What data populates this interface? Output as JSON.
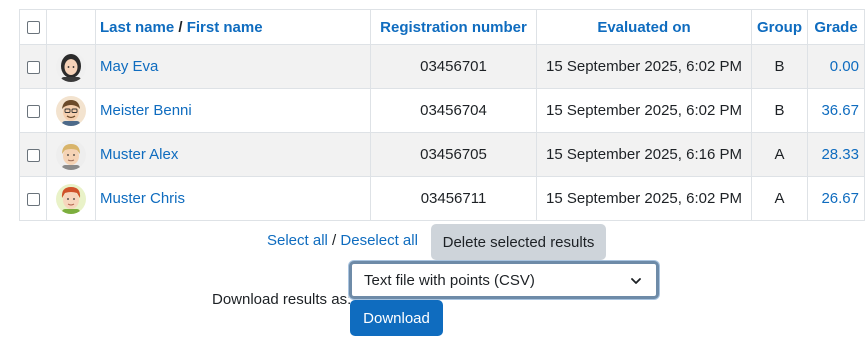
{
  "table": {
    "headers": {
      "last_name": "Last name",
      "separator": " / ",
      "first_name": "First name",
      "registration": "Registration number",
      "evaluated": "Evaluated on",
      "group": "Group",
      "grade": "Grade"
    },
    "rows": [
      {
        "name": "May Eva",
        "registration": "03456701",
        "evaluated": "15 September 2025, 6:02 PM",
        "group": "B",
        "grade": "0.00",
        "avatar": "female-avatar-dark-hair"
      },
      {
        "name": "Meister Benni",
        "registration": "03456704",
        "evaluated": "15 September 2025, 6:02 PM",
        "group": "B",
        "grade": "36.67",
        "avatar": "male-avatar-glasses"
      },
      {
        "name": "Muster Alex",
        "registration": "03456705",
        "evaluated": "15 September 2025, 6:16 PM",
        "group": "A",
        "grade": "28.33",
        "avatar": "male-avatar-blond"
      },
      {
        "name": "Muster Chris",
        "registration": "03456711",
        "evaluated": "15 September 2025, 6:02 PM",
        "group": "A",
        "grade": "26.67",
        "avatar": "male-avatar-red-hair"
      }
    ]
  },
  "actions": {
    "select_all": "Select all",
    "separator": " / ",
    "deselect_all": "Deselect all",
    "delete_selected": "Delete selected results"
  },
  "download": {
    "label": "Download results as:",
    "selected_format": "Text file with points (CSV)",
    "button": "Download"
  },
  "colors": {
    "link": "#0f6cbf",
    "primary_button": "#0f6cbf",
    "secondary_button": "#ced4da",
    "row_stripe": "#f2f2f2"
  }
}
